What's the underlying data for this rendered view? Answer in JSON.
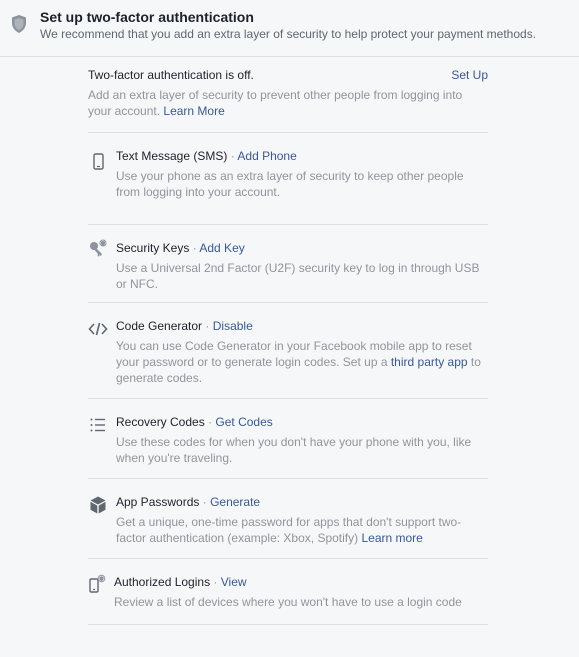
{
  "header": {
    "title": "Set up two-factor authentication",
    "subtitle": "We recommend that you add an extra layer of security to help protect your payment methods.",
    "icon": "shield-icon"
  },
  "status": {
    "text": "Two-factor authentication is off.",
    "setup_label": "Set Up",
    "description": "Add an extra layer of security to prevent other people from logging into your account.",
    "learn_more": "Learn More"
  },
  "methods": [
    {
      "name": "Text Message (SMS)",
      "separator": "·",
      "action": "Add Phone",
      "icon": "phone-icon",
      "description": "Use your phone as an extra layer of security to keep other people from logging into your account."
    },
    {
      "name": "Security Keys",
      "separator": "·",
      "action": "Add Key",
      "icon": "key-icon",
      "description": "Use a Universal 2nd Factor (U2F) security key to log in through USB or NFC."
    },
    {
      "name": "Code Generator",
      "separator": "·",
      "action": "Disable",
      "icon": "code-icon",
      "description_pre": "You can use Code Generator in your Facebook mobile app to reset your password or to generate login codes. Set up a ",
      "description_link": "third party app",
      "description_post": " to generate codes."
    },
    {
      "name": "Recovery Codes",
      "separator": "·",
      "action": "Get Codes",
      "icon": "list-icon",
      "description": "Use these codes for when you don't have your phone with you, like when you're traveling."
    },
    {
      "name": "App Passwords",
      "separator": "·",
      "action": "Generate",
      "icon": "box-icon",
      "description_pre": "Get a unique, one-time password for apps that don't support two-factor authentication (example: Xbox, Spotify) ",
      "description_link": "Learn more"
    },
    {
      "name": "Authorized Logins",
      "separator": "·",
      "action": "View",
      "icon": "device-icon",
      "description": "Review a list of devices where you won't have to use a login code"
    }
  ],
  "colors": {
    "link": "#385898",
    "muted": "#90949c",
    "text": "#1d2129",
    "divider": "#dddfe2",
    "background": "#f6f7f9"
  }
}
